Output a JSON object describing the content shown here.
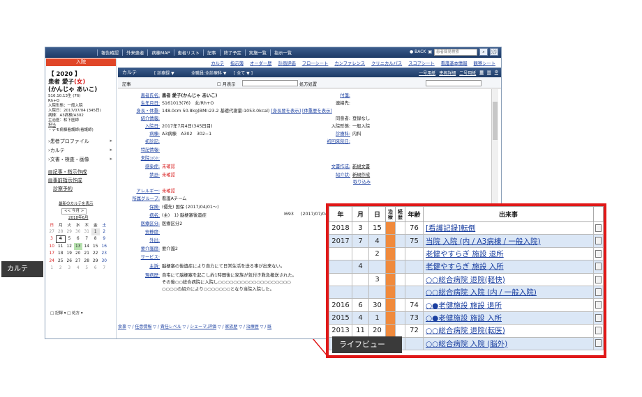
{
  "topbar": {
    "menu": [
      "報告確認",
      "外来患者",
      "病棟MAP",
      "患者リスト",
      "記事",
      "終了予定",
      "実施一覧",
      "指示一覧"
    ],
    "back": "● BACK",
    "search_placeholder": "患者簡易検索",
    "logout": "LOG OUT"
  },
  "left": {
    "admission": "入院",
    "id": "【 2020 】",
    "name": "患者 愛子(女)",
    "kana": "(かんじゃ あいこ)",
    "birth": "S16.10.13生 (76)",
    "blood": "Rh+O",
    "form": "入院形態：一般入院",
    "date": "入院日：2017/07/04 (345日)",
    "ward": "病棟：A3病棟/A302",
    "doctor": "主治医：松下医師",
    "nurse_label": "担当",
    "nurse": "・デモ病棟看護師(看護師)",
    "nav": [
      "患者プロファイル",
      "カルテ",
      "文書・検査・画像"
    ],
    "links": [
      "記事・指示作成",
      "事前指示作成",
      "診察予約"
    ],
    "latest": "最新のカルテを表示",
    "cal_nav": "<< 今月 >",
    "month": "2018年6月",
    "weekdays": [
      "日",
      "月",
      "火",
      "水",
      "木",
      "金",
      "土"
    ],
    "weeks": [
      [
        "27",
        "28",
        "29",
        "30",
        "31",
        "1",
        "2"
      ],
      [
        "3",
        "4",
        "5",
        "6",
        "7",
        "8",
        "9"
      ],
      [
        "10",
        "11",
        "12",
        "13",
        "14",
        "15",
        "16"
      ],
      [
        "17",
        "18",
        "19",
        "20",
        "21",
        "22",
        "23"
      ],
      [
        "24",
        "25",
        "26",
        "27",
        "28",
        "29",
        "30"
      ],
      [
        "1",
        "2",
        "3",
        "4",
        "5",
        "6",
        "7"
      ]
    ],
    "legend1": "記録",
    "legend2": "処方",
    "karute": "カルテ"
  },
  "main": {
    "tabs": [
      "カルテ",
      "指示簿",
      "オーダー歴",
      "計画評価",
      "フローシート",
      "カンファレンス",
      "クリニカルパス",
      "スコアシート",
      "看護基本情報",
      "観察シート"
    ],
    "title": "カルテ",
    "dd1": "[ 診療録 ▼",
    "dd2": "全職員:全診療科 ▼",
    "dd3": "[ 全て ▼ ]",
    "sub_links": [
      "一号用紙",
      "患者詳細",
      "二号用紙"
    ],
    "filter_label": "記事",
    "filter_check": "月表示",
    "filter_rx": "処方処置",
    "rows_left": [
      [
        "患者氏名:",
        "患者 愛子(かんじゃ あいこ)"
      ],
      [
        "生年月日:",
        "S161013(76)　女/Rh+O"
      ],
      [
        "身長・体重:",
        "148.0cm 50.8kg(BMI:23.2 基礎代謝量:1053.0kcal)"
      ],
      [
        "紹介情報:",
        ""
      ],
      [
        "入院日:",
        "2017年7月4日(345日目)"
      ],
      [
        "病棟:",
        "A3病棟　A302　302−1"
      ],
      [
        "初診記:",
        ""
      ],
      [
        "特記情報:",
        ""
      ],
      [
        "未院ｺﾒﾝﾄ:",
        ""
      ],
      [
        "感染症:",
        "未確認"
      ],
      [
        "禁忌:",
        "未確認"
      ],
      [
        "アレルギー:",
        "未確認"
      ],
      [
        "所属グループ:",
        "看護Aチーム"
      ],
      [
        "保険:",
        "(優先) 国保 (2017/04/01〜)"
      ],
      [
        "病名:",
        "(主)　1) 脳梗塞後遺症"
      ],
      [
        "医療区分:",
        "医療区分2"
      ],
      [
        "安静度:",
        ""
      ],
      [
        "外出:",
        ""
      ],
      [
        "要介護度:",
        "要介護2"
      ],
      [
        "サービス:",
        ""
      ],
      [
        "主訴:",
        "脳梗塞の後遺症により自力にて日常生活を送る事が出来ない。"
      ],
      [
        "現病歴:",
        "自宅にて脳梗塞を起こし約1時間後に家族が気付き救急搬送された。"
      ]
    ],
    "hist_more": [
      "その後○○総合病院に入院し○○○○○○○○○○○○○○○○○○○",
      "○○○○の紹介により○○○○○○○となり当院入院した。"
    ],
    "body_links": [
      "[身長要を表示]",
      "[体重歴を表示]"
    ],
    "rows_right": [
      [
        "付箋:",
        ""
      ],
      [
        "連絡先:",
        ""
      ],
      [
        "同意者:",
        "登録なし"
      ],
      [
        "入院形態:",
        "一般入院"
      ],
      [
        "診療科:",
        "内科"
      ],
      [
        "初回来院日:",
        ""
      ],
      [
        "文書作成:",
        "新規文書"
      ],
      [
        "紹介状:",
        "新規作成"
      ]
    ],
    "extra_link": "取り込み",
    "code": "I693",
    "date_frag": "(2017/07/04",
    "bottom": [
      "食事",
      "任意情報",
      "責任レベル",
      "シェーマ,評価",
      "家族歴",
      "治療歴",
      "既"
    ]
  },
  "popup": {
    "headers": [
      "年",
      "月",
      "日",
      "治療",
      "経歴",
      "年齢",
      "出来事"
    ],
    "rows": [
      [
        "2018",
        "3",
        "15",
        "",
        "",
        "76",
        "[看護記録]転倒"
      ],
      [
        "2017",
        "7",
        "4",
        "",
        "",
        "75",
        "当院 入院 (内 / A3病棟 / 一般入院)"
      ],
      [
        "",
        "",
        "2",
        "",
        "",
        "",
        "老健やすらぎ 施設 退所"
      ],
      [
        "",
        "4",
        "",
        "",
        "",
        "",
        "老健やすらぎ 施設 入所"
      ],
      [
        "",
        "",
        "3",
        "",
        "",
        "",
        "○○総合病院 退院(軽快)"
      ],
      [
        "",
        "",
        "",
        "",
        "",
        "",
        "○○総合病院 入院 (内 / 一般入院)"
      ],
      [
        "2016",
        "6",
        "30",
        "",
        "",
        "74",
        "○●老健施設 施設 退所"
      ],
      [
        "2015",
        "4",
        "1",
        "",
        "",
        "73",
        "○●老健施設 施設 入所"
      ],
      [
        "2013",
        "11",
        "20",
        "",
        "",
        "72",
        "○○総合病院 退院(転医)"
      ],
      [
        "",
        "",
        "",
        "",
        "",
        "",
        "○○総合病院 入院 (脳外)"
      ]
    ],
    "label": "ライフビュー"
  }
}
